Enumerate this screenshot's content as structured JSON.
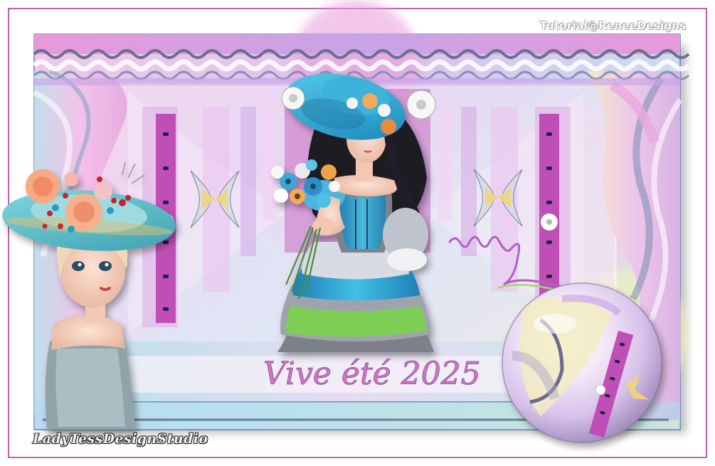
{
  "watermark": "Tutorial@ReneeDesigns",
  "title_text": "Vive été 2025",
  "signature": "LadyTessDesignStudio",
  "colors": {
    "frame_line": "#b12c8e",
    "inner_frame_line": "#3e63b6",
    "pink": "#e79ad9",
    "lilac": "#c7a4e6",
    "sky": "#a9dcef",
    "cream": "#f2ecc2",
    "magenta_bar": "#bf4fb6",
    "navy_dot": "#1c2340",
    "dress_blue": "#2aa9d6",
    "dress_green": "#7fcf57",
    "rose": "#f3a17f"
  },
  "elements": {
    "left_figure": "girl-with-floral-hat",
    "center_figure": "lady-with-bouquet",
    "orb": "decorated-sphere"
  }
}
